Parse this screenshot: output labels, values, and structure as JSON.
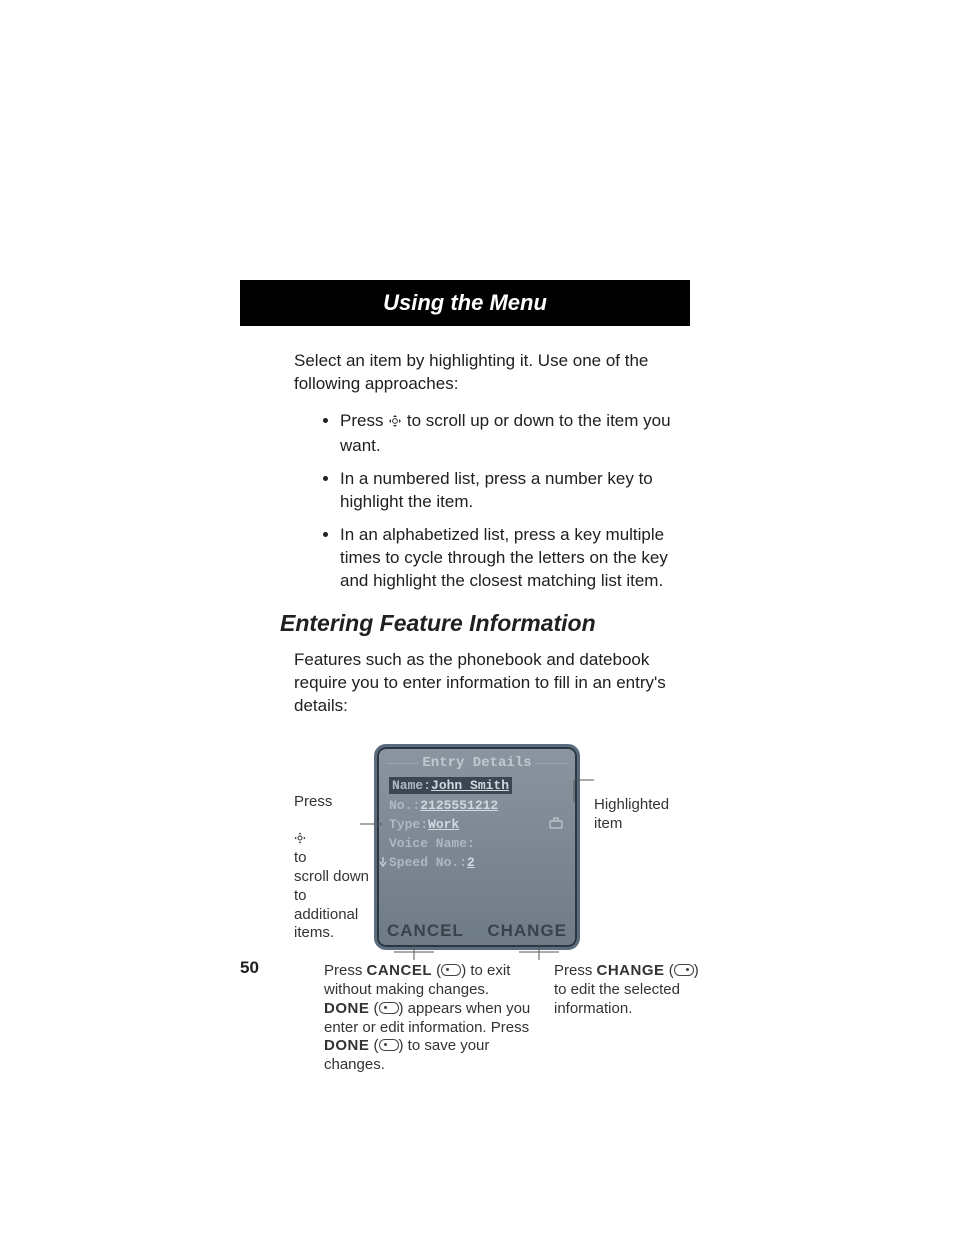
{
  "header": {
    "title": "Using the Menu"
  },
  "intro": "Select an item by highlighting it. Use one of the following approaches:",
  "bullets": [
    "Press     to scroll up or down to the item you want.",
    "In a numbered list, press a number key to highlight the item.",
    "In an alphabetized list, press a key multiple times to cycle through the letters on the key and highlight the closest matching list item."
  ],
  "section_heading": "Entering Feature Information",
  "features_intro": "Features such as the phonebook and datebook require you to enter information to fill in an entry's details:",
  "screen": {
    "title": "Entry Details",
    "fields": {
      "name_label": "Name:",
      "name_value": "John Smith",
      "no_label": "No.:",
      "no_value": "2125551212",
      "type_label": "Type:",
      "type_value": "Work",
      "voice_label": "Voice Name:",
      "voice_value": "",
      "speed_label": "Speed No.:",
      "speed_value": "2"
    },
    "softkeys": {
      "left": "CANCEL",
      "right": "CHANGE"
    }
  },
  "callouts": {
    "left": "Press    to\nscroll down\nto additional\nitems.",
    "right": "Highlighted item",
    "bl_1a": "Press ",
    "bl_1b": "CANCEL",
    "bl_1c": " (",
    "bl_1d": ") to exit without making changes.",
    "bl_2a": "DONE",
    "bl_2b": " (",
    "bl_2c": ") appears when you enter or edit information. Press",
    "bl_3a": "DONE",
    "bl_3b": " (",
    "bl_3c": ") to save your changes.",
    "br_1a": "Press ",
    "br_1b": "CHANGE",
    "br_1c": " (",
    "br_1d": ") to edit the selected information."
  },
  "page_number": "50"
}
